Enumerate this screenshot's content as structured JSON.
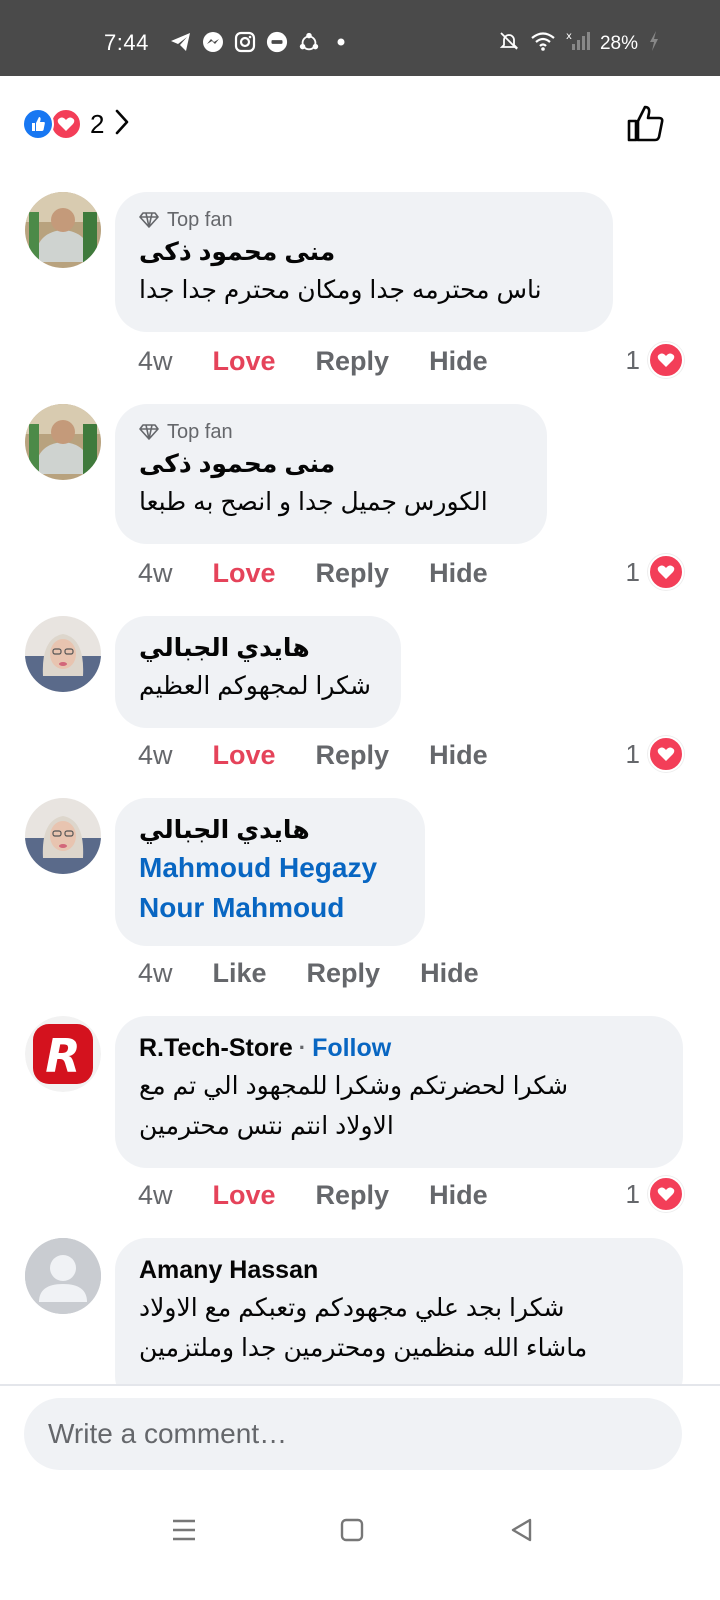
{
  "status_bar": {
    "time": "7:44",
    "battery": "28%",
    "icons": [
      "telegram-icon",
      "messenger-icon",
      "instagram-icon",
      "uber-icon",
      "sync-icon",
      "dot-icon",
      "mute-icon",
      "wifi-icon",
      "signal-icon",
      "charging-icon"
    ]
  },
  "reactions_header": {
    "count": "2",
    "like_color": "#1877f2",
    "love_color": "#f33e58"
  },
  "comments": [
    {
      "badge": "Top fan",
      "author": "منى محمود ذكى",
      "text": "ناس محترمه جدا ومكان محترم جدا جدا",
      "time": "4w",
      "react_label": "Love",
      "reply_label": "Reply",
      "hide_label": "Hide",
      "reaction_count": "1"
    },
    {
      "badge": "Top fan",
      "author": "منى محمود ذكى",
      "text": "الكورس جميل جدا و انصح به طبعا",
      "time": "4w",
      "react_label": "Love",
      "reply_label": "Reply",
      "hide_label": "Hide",
      "reaction_count": "1"
    },
    {
      "author": "هايدي الجبالي",
      "text": "شكرا لمجهوكم العظيم",
      "time": "4w",
      "react_label": "Love",
      "reply_label": "Reply",
      "hide_label": "Hide",
      "reaction_count": "1"
    },
    {
      "author": "هايدي الجبالي",
      "mentions": [
        "Mahmoud Hegazy",
        "Nour Mahmoud"
      ],
      "time": "4w",
      "react_label": "Like",
      "reply_label": "Reply",
      "hide_label": "Hide"
    },
    {
      "author": "R.Tech-Store",
      "follow_label": "Follow",
      "text_lines": [
        "شكرا لحضرتكم وشكرا للمجهود الي تم مع",
        "الاولاد انتم نتس محترمين"
      ],
      "time": "4w",
      "react_label": "Love",
      "reply_label": "Reply",
      "hide_label": "Hide",
      "reaction_count": "1"
    },
    {
      "author": "Amany Hassan",
      "text_lines": [
        "شكرا بجد علي مجهودكم وتعبكم مع الاولاد",
        "ماشاء الله منظمين ومحترمين جدا وملتزمين"
      ]
    }
  ],
  "composer": {
    "placeholder": "Write a comment…"
  },
  "colors": {
    "love_accent": "#e5435a",
    "link_blue": "#0866c2",
    "bubble_bg": "#f0f2f5"
  }
}
